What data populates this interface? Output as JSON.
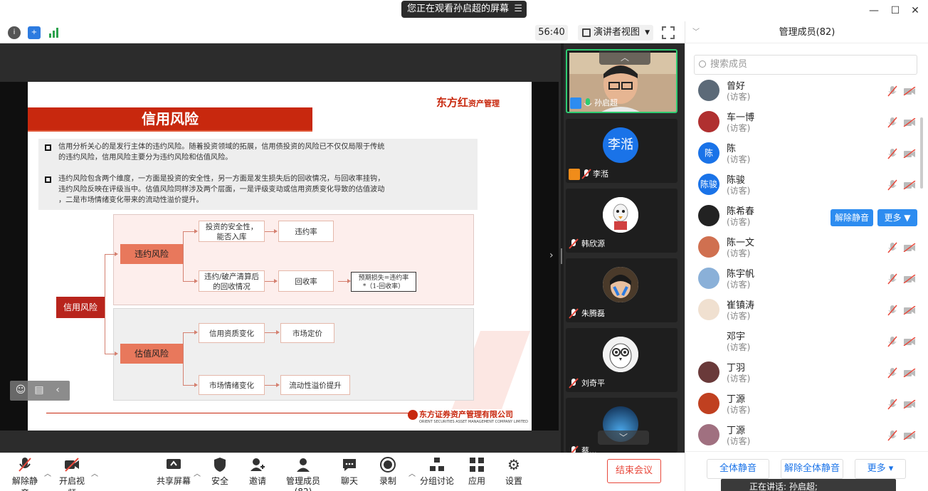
{
  "window": {
    "banner": "您正在观看孙启超的屏幕",
    "timer": "56:40",
    "view_mode": "演讲者视图"
  },
  "slide": {
    "title": "信用风险",
    "logo_main": "东方红",
    "logo_sub": "资产管理",
    "para1_line1": "信用分析关心的是发行主体的违约风险。随着投资领域的拓展，信用债投资的风险已不仅仅局限于传统",
    "para1_line2": "的违约风险，信用风险主要分为违约风险和估值风险。",
    "para2_line1": "违约风险包含两个维度，一方面是投资的安全性，另一方面是发生损失后的回收情况，与回收率挂钩，",
    "para2_line2": "违约风险反映在评级当中。估值风险同样涉及两个层面，一是评级变动或信用资质变化导致的估值波动",
    "para2_line3": "，二是市场情绪变化带来的流动性溢价提升。",
    "n_credit": "信用风险",
    "n_default": "违约风险",
    "n_valuation": "估值风险",
    "n_safety": "投资的安全性，能否入库",
    "n_default_rate": "违约率",
    "n_recovery_case": "违约/破产清算后的回收情况",
    "n_recovery_rate": "回收率",
    "n_expected_loss_1": "预期损失=违约率",
    "n_expected_loss_2": "*（1-回收率）",
    "n_credit_change": "信用资质变化",
    "n_market_price": "市场定价",
    "n_sentiment": "市场情绪变化",
    "n_liquidity": "流动性溢价提升",
    "footer_company": "东方证券资产管理有限公司",
    "footer_en": "ORIENT SECURITIES ASSET MANAGEMENT COMPANY LIMITED"
  },
  "videos": [
    {
      "name": "孙启超"
    },
    {
      "name": "李湉",
      "avatar_text": "李湉"
    },
    {
      "name": "韩欣源"
    },
    {
      "name": "朱腾磊"
    },
    {
      "name": "刘奇平"
    },
    {
      "name": "蔡..."
    }
  ],
  "panel": {
    "title": "管理成员(82)",
    "search_placeholder": "搜索成员",
    "members": [
      {
        "name": "曾好",
        "role": "(访客)"
      },
      {
        "name": "车一博",
        "role": "(访客)"
      },
      {
        "name": "陈",
        "role": "(访客)",
        "avatar_text": "陈"
      },
      {
        "name": "陈骏",
        "role": "(访客)",
        "avatar_text": "陈骏"
      },
      {
        "name": "陈希春",
        "role": "(访客)"
      },
      {
        "name": "陈一文",
        "role": "(访客)"
      },
      {
        "name": "陈宇帆",
        "role": "(访客)"
      },
      {
        "name": "崔镇涛",
        "role": "(访客)"
      },
      {
        "name": "邓宇",
        "role": "(访客)"
      },
      {
        "name": "丁羽",
        "role": "(访客)"
      },
      {
        "name": "丁源",
        "role": "(访客)"
      },
      {
        "name": "丁源",
        "role": "(访客)"
      }
    ],
    "unmute_btn": "解除静音",
    "more_btn": "更多",
    "mute_all": "全体静音",
    "unmute_all": "解除全体静音",
    "more_footer": "更多",
    "speaking": "正在讲话: 孙启超;"
  },
  "toolbar": {
    "unmute": "解除静音",
    "video": "开启视频",
    "share": "共享屏幕",
    "security": "安全",
    "invite": "邀请",
    "members": "管理成员(82)",
    "chat": "聊天",
    "record": "录制",
    "breakout": "分组讨论",
    "apps": "应用",
    "settings": "设置",
    "end": "结束会议"
  },
  "colors": {
    "accent": "#2d8cf0",
    "slide_red": "#c8280e",
    "end_red": "#e8483b"
  }
}
